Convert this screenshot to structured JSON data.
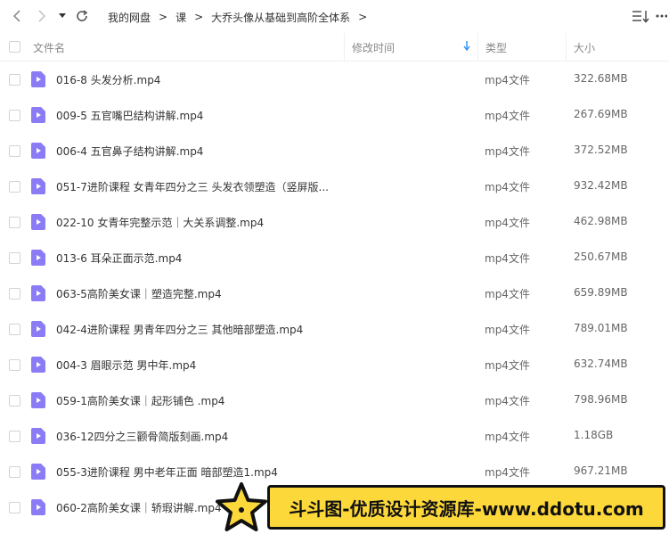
{
  "nav": {
    "back_icon": "chevron-left-icon",
    "forward_icon": "chevron-right-icon",
    "dropdown_icon": "caret-down-icon",
    "refresh_icon": "refresh-icon"
  },
  "breadcrumb": {
    "items": [
      "我的网盘",
      "课",
      "大乔头像从基础到高阶全体系"
    ],
    "separator": ">"
  },
  "toolbar": {
    "sort_icon": "sort-list-icon",
    "more_icon": "more-dots-icon"
  },
  "columns": {
    "name": "文件名",
    "modified": "修改时间",
    "type": "类型",
    "size": "大小",
    "sorted_column": "modified",
    "sort_direction": "descending"
  },
  "files": [
    {
      "name": "016-8 头发分析.mp4",
      "type": "mp4文件",
      "size": "322.68MB"
    },
    {
      "name": "009-5 五官嘴巴结构讲解.mp4",
      "type": "mp4文件",
      "size": "267.69MB"
    },
    {
      "name": "006-4 五官鼻子结构讲解.mp4",
      "type": "mp4文件",
      "size": "372.52MB"
    },
    {
      "name": "051-7进阶课程 女青年四分之三 头发衣领塑造（竖屏版...",
      "type": "mp4文件",
      "size": "932.42MB"
    },
    {
      "name": "022-10 女青年完整示范｜大关系调整.mp4",
      "type": "mp4文件",
      "size": "462.98MB"
    },
    {
      "name": "013-6 耳朵正面示范.mp4",
      "type": "mp4文件",
      "size": "250.67MB"
    },
    {
      "name": "063-5高阶美女课｜塑造完整.mp4",
      "type": "mp4文件",
      "size": "659.89MB"
    },
    {
      "name": "042-4进阶课程 男青年四分之三 其他暗部塑造.mp4",
      "type": "mp4文件",
      "size": "789.01MB"
    },
    {
      "name": "004-3  眉眼示范 男中年.mp4",
      "type": "mp4文件",
      "size": "632.74MB"
    },
    {
      "name": "059-1高阶美女课｜起形铺色 .mp4",
      "type": "mp4文件",
      "size": "798.96MB"
    },
    {
      "name": "036-12四分之三颧骨简版刻画.mp4",
      "type": "mp4文件",
      "size": "1.18GB"
    },
    {
      "name": "055-3进阶课程 男中老年正面 暗部塑造1.mp4",
      "type": "mp4文件",
      "size": "967.21MB"
    },
    {
      "name": "060-2高阶美女课｜轿瑕讲解.mp4",
      "type": "mp4文件",
      "size": ""
    }
  ],
  "file_icon": "video-file-icon",
  "colors": {
    "accent": "#2f8ff1",
    "file_icon": "#8b7cf6",
    "watermark_bg": "#fdd83a"
  },
  "watermark": {
    "text": "斗斗图-优质设计资源库-www.ddotu.com"
  }
}
